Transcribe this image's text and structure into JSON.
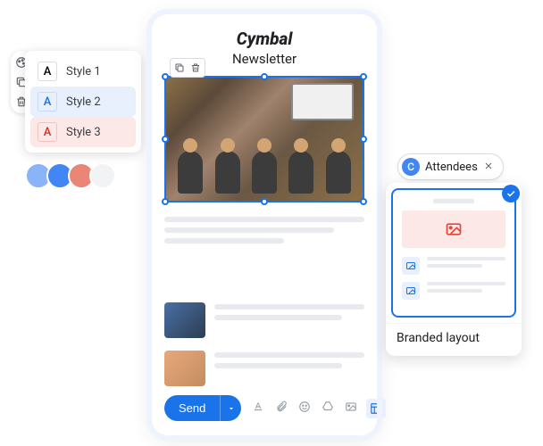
{
  "styles": {
    "items": [
      {
        "letter": "A",
        "label": "Style 1"
      },
      {
        "letter": "A",
        "label": "Style 2"
      },
      {
        "letter": "A",
        "label": "Style 3"
      }
    ]
  },
  "swatches": [
    "#8ab4f8",
    "#4285f4",
    "#ea8676",
    "#f1f3f4"
  ],
  "newsletter": {
    "brand": "Cymbal",
    "subtitle": "Newsletter"
  },
  "actions": {
    "send": "Send"
  },
  "attendees": {
    "avatar_letter": "C",
    "label": "Attendees"
  },
  "layout": {
    "label": "Branded layout"
  }
}
